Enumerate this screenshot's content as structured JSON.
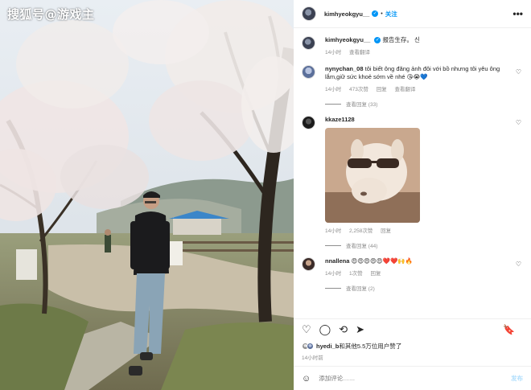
{
  "watermark": "搜狐号@游戏主",
  "header": {
    "username": "kimhyeokgyu__",
    "verified_mark": "✓",
    "separator": "•",
    "follow_label": "关注",
    "more": "•••"
  },
  "comments": [
    {
      "username": "kimhyeokgyu__",
      "text": "报告生存。 신",
      "time": "14小时",
      "translate": "查看翻译"
    },
    {
      "username": "nynychan_08",
      "text": "tôi biết ông đăng ảnh đôi với bồ nhưng tôi yêu ông lắm,giữ sức khoẻ sớm về nhé 😘😭💙",
      "time": "14小时",
      "likes": "473次赞",
      "reply": "回复",
      "translate": "查看翻译",
      "view_replies": "查看回复 (33)"
    },
    {
      "username": "kkaze1128",
      "text": "",
      "time": "14小时",
      "likes": "2,258次赞",
      "reply": "回复",
      "view_replies": "查看回复 (44)"
    },
    {
      "username": "nnallena",
      "text": "😍😍😍😍😍❤️❤️🙌🔥",
      "time": "14小时",
      "likes": "1次赞",
      "reply": "回复",
      "view_replies": "查看回复 (2)"
    }
  ],
  "likes_line": {
    "user": "hyedi_b",
    "rest": "和其他5.5万位用户赞了"
  },
  "post_time": "14小时前",
  "add_comment": {
    "placeholder": "添加评论……",
    "post_label": "发布"
  },
  "icons": {
    "heart": "♡",
    "comment": "◯",
    "share": "⟲",
    "send": "➤",
    "bookmark": "🔖",
    "emoji": "☺"
  },
  "colors": {
    "accent": "#0095f6",
    "muted": "#8e8e8e",
    "text": "#262626"
  }
}
